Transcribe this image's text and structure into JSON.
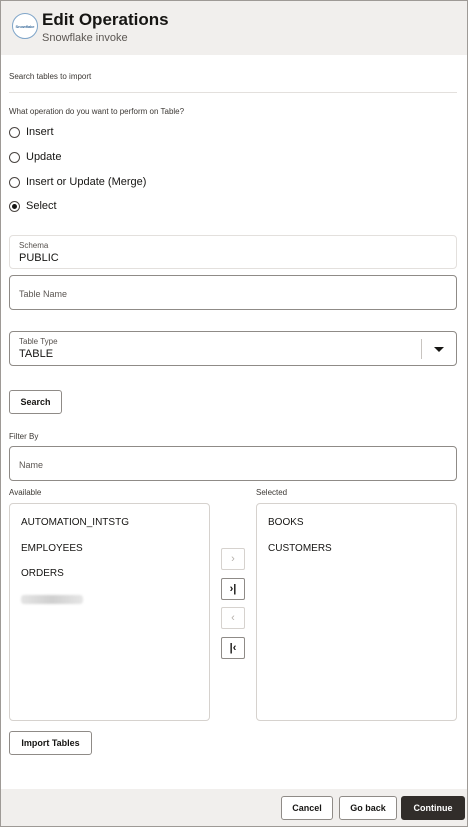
{
  "header": {
    "logo_text": "Snowflake",
    "title": "Edit Operations",
    "subtitle": "Snowflake invoke"
  },
  "section": {
    "search_tables_label": "Search tables to import",
    "operation_question": "What operation do you want to perform on Table?"
  },
  "operations": [
    {
      "label": "Insert",
      "checked": false
    },
    {
      "label": "Update",
      "checked": false
    },
    {
      "label": "Insert or Update (Merge)",
      "checked": false
    },
    {
      "label": "Select",
      "checked": true
    }
  ],
  "schema": {
    "label": "Schema",
    "value": "PUBLIC"
  },
  "table_name": {
    "placeholder": "Table Name"
  },
  "table_type": {
    "label": "Table Type",
    "value": "TABLE"
  },
  "search_button": "Search",
  "filter": {
    "label": "Filter By",
    "placeholder": "Name"
  },
  "available": {
    "label": "Available",
    "items": [
      "AUTOMATION_INTSTG",
      "EMPLOYEES",
      "ORDERS"
    ]
  },
  "selected": {
    "label": "Selected",
    "items": [
      "BOOKS",
      "CUSTOMERS"
    ]
  },
  "shuttle": {
    "move_right": "›",
    "move_all_right": "›|",
    "move_left": "‹",
    "move_all_left": "|‹"
  },
  "import_button": "Import Tables",
  "footer": {
    "cancel": "Cancel",
    "go_back": "Go back",
    "continue": "Continue"
  }
}
